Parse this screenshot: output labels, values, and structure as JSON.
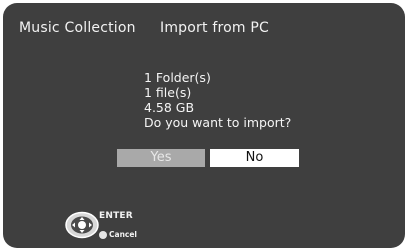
{
  "header": {
    "title": "Music Collection",
    "subtitle": "Import from PC"
  },
  "message": {
    "folders": "1 Folder(s)",
    "files": "1 file(s)",
    "size": "4.58 GB",
    "question": "Do you want to import?"
  },
  "buttons": {
    "yes_label": "Yes",
    "no_label": "No",
    "focused": "No"
  },
  "footer": {
    "enter_label": "ENTER",
    "cancel_label": "Cancel",
    "remote_icon": "dpad-enter-icon",
    "cancel_icon": "cancel-button-icon"
  },
  "colors": {
    "background": "#3f3f3f",
    "button_selected": "#ffffff",
    "button_unselected": "#a9a9a9",
    "text": "#f2f2f2"
  }
}
